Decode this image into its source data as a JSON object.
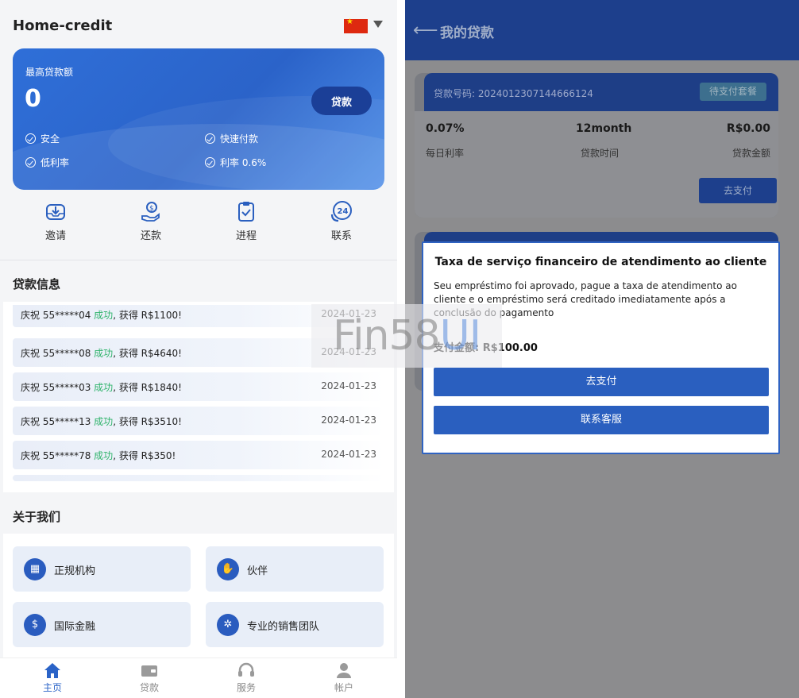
{
  "left": {
    "app_title": "Home-credit",
    "hero": {
      "label": "最高贷款额",
      "amount": "0",
      "loan_button": "贷款",
      "features": [
        "安全",
        "快速付款",
        "低利率",
        "利率 0.6%"
      ]
    },
    "quick_actions": [
      {
        "label": "邀请",
        "icon": "inbox-download-icon"
      },
      {
        "label": "还款",
        "icon": "hand-coin-icon"
      },
      {
        "label": "进程",
        "icon": "clipboard-check-icon"
      },
      {
        "label": "联系",
        "icon": "phone-24-icon"
      }
    ],
    "loan_info": {
      "title": "贷款信息",
      "rows": [
        {
          "prefix": "庆祝 55*****04 ",
          "status": "成功",
          "suffix": ", 获得 R$1100!",
          "date": "2024-01-23"
        },
        {
          "prefix": "庆祝 55*****08 ",
          "status": "成功",
          "suffix": ", 获得 R$4640!",
          "date": "2024-01-23"
        },
        {
          "prefix": "庆祝 55*****03 ",
          "status": "成功",
          "suffix": ", 获得 R$1840!",
          "date": "2024-01-23"
        },
        {
          "prefix": "庆祝 55*****13 ",
          "status": "成功",
          "suffix": ", 获得 R$3510!",
          "date": "2024-01-23"
        },
        {
          "prefix": "庆祝 55*****78 ",
          "status": "成功",
          "suffix": ", 获得 R$350!",
          "date": "2024-01-23"
        }
      ]
    },
    "about": {
      "title": "关于我们",
      "cards": [
        {
          "label": "正规机构",
          "icon": "building-icon"
        },
        {
          "label": "伙伴",
          "icon": "handshake-icon"
        },
        {
          "label": "国际金融",
          "icon": "finance-hand-icon"
        },
        {
          "label": "专业的销售团队",
          "icon": "team-icon"
        }
      ]
    },
    "tabs": [
      {
        "label": "主页",
        "icon": "home-icon",
        "active": true
      },
      {
        "label": "贷款",
        "icon": "wallet-icon",
        "active": false
      },
      {
        "label": "服务",
        "icon": "headset-icon",
        "active": false
      },
      {
        "label": "帐户",
        "icon": "user-icon",
        "active": false
      }
    ]
  },
  "right": {
    "title": "我的贷款",
    "order": {
      "number": "贷款号码: 2024012307144666124",
      "status": "待支付套餐",
      "rate_value": "0.07%",
      "rate_label": "每日利率",
      "term_value": "12month",
      "term_label": "贷款时间",
      "amount_value": "R$0.00",
      "amount_label": "贷款金额",
      "pay_button": "去支付"
    },
    "modal": {
      "title": "Taxa de serviço financeiro de atendimento ao cliente",
      "text": "Seu empréstimo foi aprovado, pague a taxa de atendimento ao cliente e o empréstimo será creditado imediatamente após a conclusão do pagamento",
      "amount": "支付金额: R$100.00",
      "pay_button": "去支付",
      "contact_button": "联系客服"
    }
  },
  "watermark": {
    "text_a": "Fin58",
    "text_b": "UI"
  },
  "colors": {
    "primary": "#2a5fbf",
    "header_dark": "#1d3f8c",
    "success": "#2fb36b"
  }
}
